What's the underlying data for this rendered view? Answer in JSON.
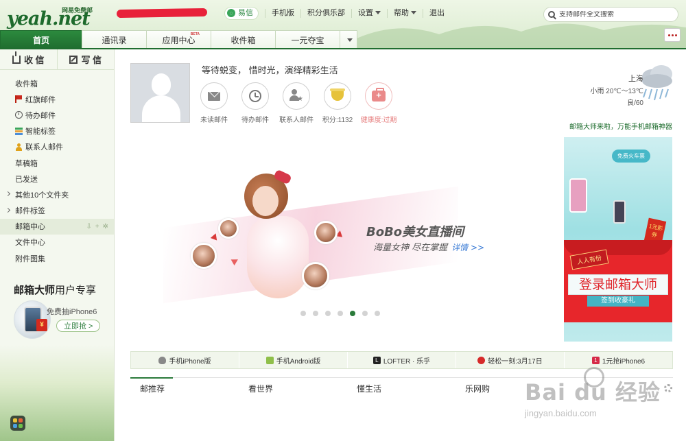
{
  "header": {
    "logo_text": "yeah.net",
    "logo_sub": "网易免费邮",
    "nav": [
      "易信",
      "手机版",
      "积分俱乐部",
      "设置",
      "帮助",
      "退出"
    ],
    "search_placeholder": "支持邮件全文搜索"
  },
  "tabs": [
    {
      "label": "首页",
      "active": true
    },
    {
      "label": "通讯录"
    },
    {
      "label": "应用中心",
      "badge": "BETA"
    },
    {
      "label": "收件箱"
    },
    {
      "label": "一元夺宝"
    }
  ],
  "sidebar": {
    "receive_label": "收 信",
    "write_label": "写 信",
    "folders": [
      {
        "label": "收件箱"
      },
      {
        "label": "红旗邮件",
        "icon": "flag-icon"
      },
      {
        "label": "待办邮件",
        "icon": "clock-icon"
      },
      {
        "label": "智能标签",
        "icon": "tags-icon"
      },
      {
        "label": "联系人邮件",
        "icon": "contact-icon"
      },
      {
        "label": "草稿箱"
      },
      {
        "label": "已发送"
      },
      {
        "label": "其他10个文件夹"
      },
      {
        "label": "邮件标签"
      },
      {
        "label": "邮箱中心"
      },
      {
        "label": "文件中心"
      },
      {
        "label": "附件图集"
      }
    ],
    "promo": {
      "title_bold": "邮箱大师",
      "title_rest": "用户专享",
      "desc": "免费抽iPhone6",
      "button": "立即抢 >"
    }
  },
  "profile": {
    "motto": "等待蜕变， 惜时光，演绎精彩生活",
    "quick_items": [
      {
        "label": "未读邮件",
        "icon": "envelope-icon"
      },
      {
        "label": "待办邮件",
        "icon": "clock-icon"
      },
      {
        "label": "联系人邮件",
        "icon": "contact-star-icon"
      },
      {
        "label": "积分:1132",
        "icon": "cup-icon"
      },
      {
        "label": "健康度:过期",
        "icon": "medkit-icon"
      }
    ]
  },
  "weather": {
    "city": "上海",
    "temp": "小雨 20℃～13℃",
    "aqi": "良/60"
  },
  "ad_link": "邮箱大师来啦，万能手机邮箱神器",
  "side_ad": {
    "bubble": "免费火车票",
    "ribbon": "人人有份",
    "banner": "登录邮箱大师",
    "sub": "签到收豪礼",
    "redbox": "1元影券"
  },
  "carousel": {
    "brand": "BoBo美女直播间",
    "slogan": "海量女神  尽在掌握",
    "detail": "详情 >>",
    "dots_total": 7,
    "dots_active": 5
  },
  "app_strip": [
    {
      "label": "手机iPhone版",
      "icon": "apple-icon",
      "color": "#888888"
    },
    {
      "label": "手机Android版",
      "icon": "android-icon",
      "color": "#8fbf4a"
    },
    {
      "label": "LOFTER · 乐乎",
      "icon": "lofter-icon",
      "color": "#222222"
    },
    {
      "label": "轻松一刻:3月17日",
      "icon": "target-icon",
      "color": "#d62a2a"
    },
    {
      "label": "1元抢iPhone6",
      "icon": "one-yuan-icon",
      "color": "#d62a48"
    }
  ],
  "news_tabs": [
    "邮推荐",
    "看世界",
    "懂生活",
    "乐网购"
  ],
  "watermark": {
    "brand": "Bai du 经验",
    "url": "jingyan.baidu.com"
  },
  "colors": {
    "brand_green": "#1f6d2f",
    "accent_red": "#d83a3a"
  }
}
